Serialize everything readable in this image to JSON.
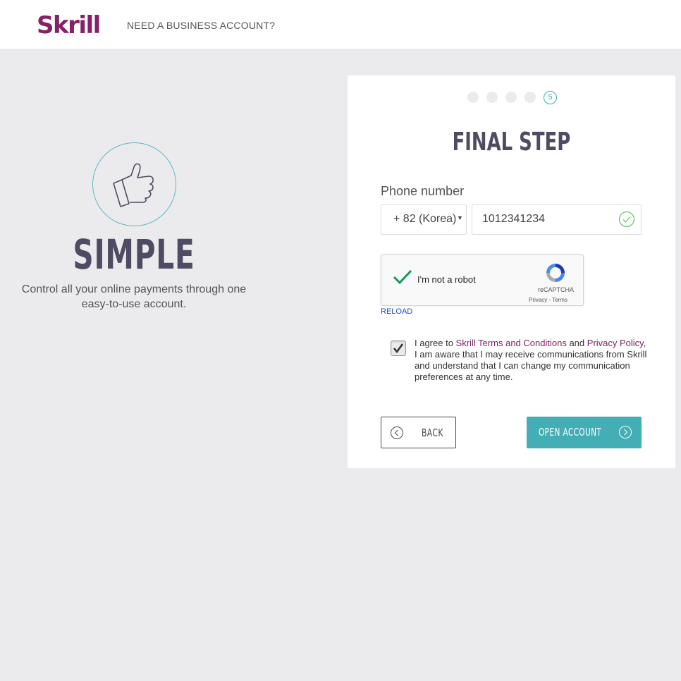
{
  "header": {
    "logo": "Skrill",
    "business_link": "NEED A BUSINESS ACCOUNT?"
  },
  "hero": {
    "icon": "thumbs-up-icon",
    "title": "SIMPLE",
    "description": "Control all your online payments through one easy-to-use account."
  },
  "form": {
    "progress": {
      "total_steps": 5,
      "current_step": "5"
    },
    "title": "FINAL STEP",
    "phone_label": "Phone number",
    "country_code": "+ 82 (Korea)",
    "phone_value": "1012341234",
    "phone_valid": true,
    "captcha": {
      "label": "I'm not a robot",
      "checked": true,
      "brand": "reCAPTCHA",
      "links": "Privacy - Terms"
    },
    "reload": "RELOAD",
    "agreement": {
      "checked": true,
      "prefix": "I agree to ",
      "terms_link": "Skrill Terms and Conditions",
      "and": " and ",
      "privacy_link": "Privacy Policy",
      "suffix": ", I am aware that I may receive communications from Skrill and understand that I can change my communication preferences at any time."
    },
    "back_button": "BACK",
    "submit_button": "OPEN ACCOUNT"
  },
  "colors": {
    "brand": "#862165",
    "accent": "#43aeb5",
    "background": "#ebebed"
  }
}
